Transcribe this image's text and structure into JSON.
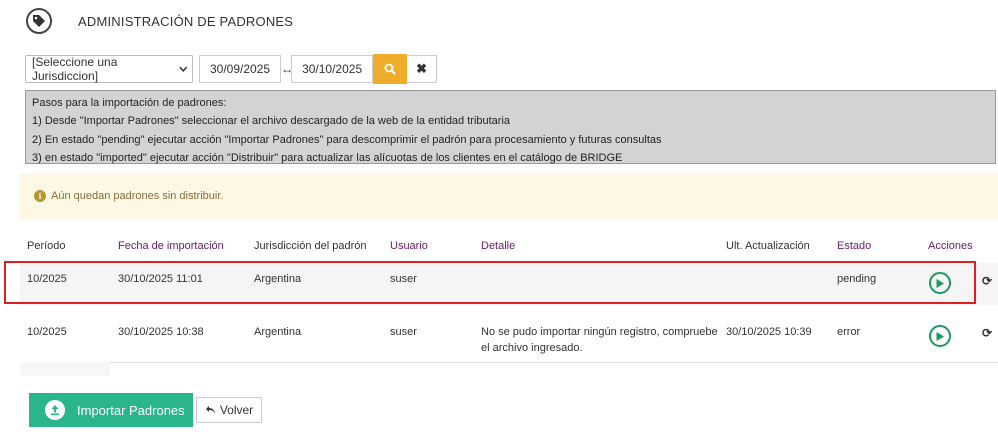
{
  "header": {
    "title": "ADMINISTRACIÓN DE PADRONES",
    "icon": "tag-icon"
  },
  "filters": {
    "jurisdiction_selected": "[Seleccione una Jurisdiccion]",
    "date_from": "30/09/2025",
    "date_to": "30/10/2025",
    "search_color": "#f0ad2a"
  },
  "steps": {
    "title": "Pasos para la importación de padrones:",
    "items": [
      "1) Desde \"Importar Padrones\" seleccionar el archivo descargado de la web de la entidad tributaria",
      "2) En estado \"pending\" ejecutar acción \"Importar Padrones\" para descomprimir el padrón para procesamiento y futuras consultas",
      "3) en estado \"imported\" ejecutar acción \"Distribuir\" para actualizar las alícuotas de los clientes en el catálogo de BRIDGE"
    ]
  },
  "warning": {
    "text": "Aún quedan padrones sin distribuir."
  },
  "table": {
    "headers": {
      "periodo": "Período",
      "fecha": "Fecha de importación",
      "jurisdiccion": "Jurisdicción del padrón",
      "usuario": "Usuario",
      "detalle": "Detalle",
      "ult": "Ult. Actualización",
      "estado": "Estado",
      "acciones": "Acciones"
    },
    "rows": [
      {
        "periodo": "10/2025",
        "fecha": "30/10/2025 11:01",
        "jurisdiccion": "Argentina",
        "usuario": "suser",
        "detalle_1": "",
        "detalle_2": "",
        "ult": "",
        "estado": "pending"
      },
      {
        "periodo": "10/2025",
        "fecha": "30/10/2025 10:38",
        "jurisdiccion": "Argentina",
        "usuario": "suser",
        "detalle_1": "No se pudo importar ningún registro, compruebe",
        "detalle_2": "el archivo ingresado.",
        "ult": "30/10/2025 10:39",
        "estado": "error"
      }
    ]
  },
  "footer": {
    "import_label": "Importar Padrones",
    "back_label": "Volver",
    "import_color": "#2bb58a"
  }
}
